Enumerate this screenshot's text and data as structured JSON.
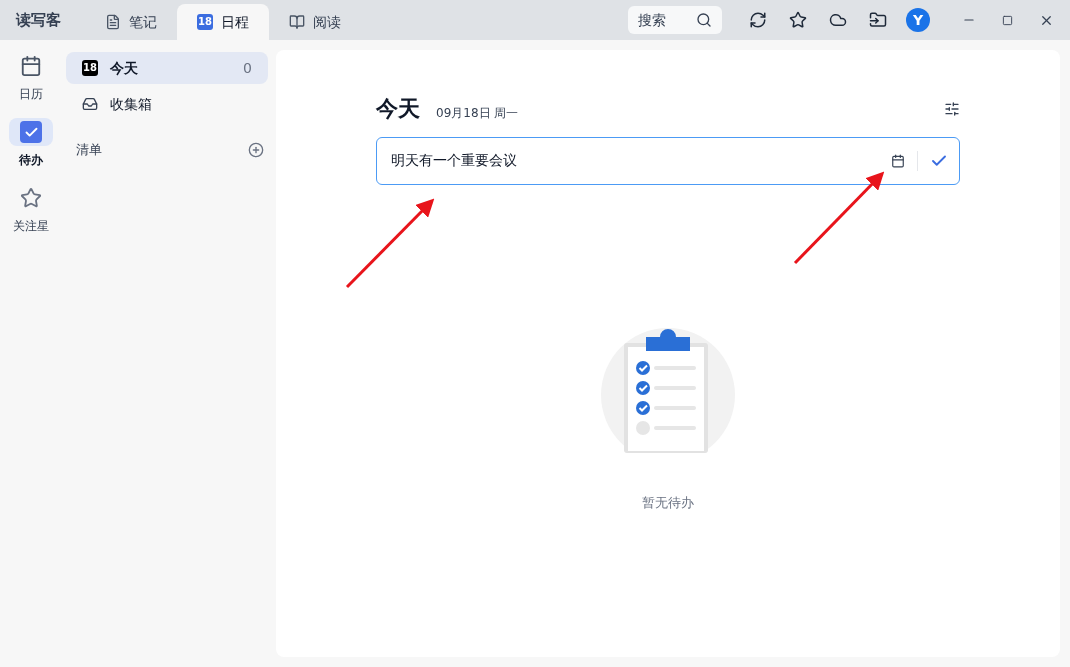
{
  "app": {
    "name": "读写客"
  },
  "tabs": [
    {
      "label": "笔记",
      "kind": "note",
      "selected": false
    },
    {
      "label": "日程",
      "kind": "date",
      "badge": "18",
      "selected": true
    },
    {
      "label": "阅读",
      "kind": "book",
      "selected": false
    }
  ],
  "search": {
    "placeholder": "搜索"
  },
  "avatar": {
    "letter": "Y"
  },
  "rail": [
    {
      "label": "日历",
      "kind": "calendar",
      "selected": false
    },
    {
      "label": "待办",
      "kind": "todo",
      "selected": true
    },
    {
      "label": "关注星",
      "kind": "star",
      "selected": false
    }
  ],
  "lists": [
    {
      "label": "今天",
      "kind": "date",
      "badge": "18",
      "count": "0",
      "selected": true
    },
    {
      "label": "收集箱",
      "kind": "inbox",
      "selected": false
    }
  ],
  "section": {
    "label": "清单"
  },
  "main": {
    "title": "今天",
    "date": "09月18日 周一",
    "input": {
      "value": "明天有一个重要会议",
      "focused": true
    }
  },
  "empty": {
    "text": "暂无待办"
  }
}
